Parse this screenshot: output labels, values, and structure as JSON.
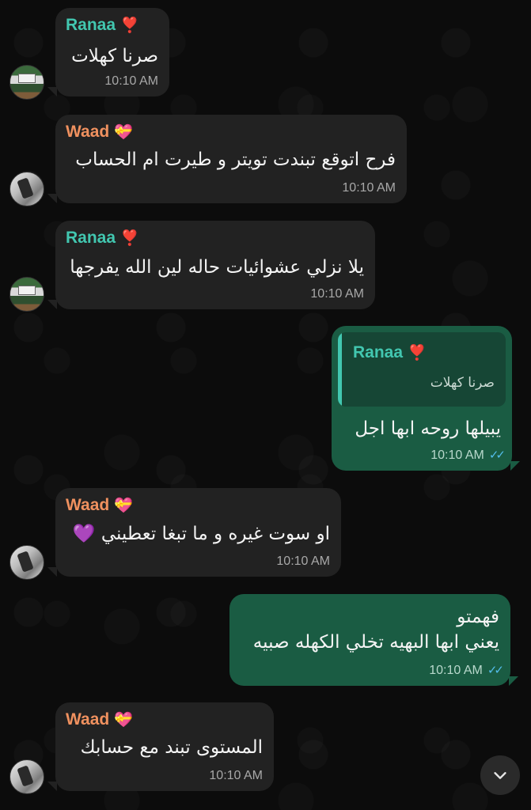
{
  "messages": [
    {
      "sender": "Ranaa",
      "sender_emoji": "❣️",
      "text": "صرنا كهلات",
      "time": "10:10 AM"
    },
    {
      "sender": "Waad",
      "sender_emoji": "💝",
      "text": "فرح اتوقع تبندت تويتر و طيرت ام الحساب",
      "time": "10:10 AM"
    },
    {
      "sender": "Ranaa",
      "sender_emoji": "❣️",
      "text": "يلا نزلي عشوائيات حاله لين الله يفرجها",
      "time": "10:10 AM"
    },
    {
      "quote_sender": "Ranaa",
      "quote_sender_emoji": "❣️",
      "quote_text": "صرنا كهلات",
      "text": "يبيلها روحه ابها اجل",
      "time": "10:10 AM",
      "ticks": "✓✓"
    },
    {
      "sender": "Waad",
      "sender_emoji": "💝",
      "text": "او سوت غيره و ما تبغا تعطيني 💜",
      "time": "10:10 AM"
    },
    {
      "line1": "فهمتو",
      "line2": "يعني ابها البهيه تخلي الكهله صبيه",
      "time": "10:10 AM",
      "ticks": "✓✓"
    },
    {
      "sender": "Waad",
      "sender_emoji": "💝",
      "text": "المستوى تبند مع حسابك",
      "time": "10:10 AM"
    }
  ],
  "colors": {
    "incoming_bubble": "#222222",
    "outgoing_bubble": "#1a5c43",
    "ranaa_name": "#42c7b0",
    "waad_name": "#f0915f",
    "read_ticks": "#53bdeb"
  },
  "icons": {
    "scroll_down": "chevron-down-icon",
    "read_receipt": "double-check-icon"
  }
}
